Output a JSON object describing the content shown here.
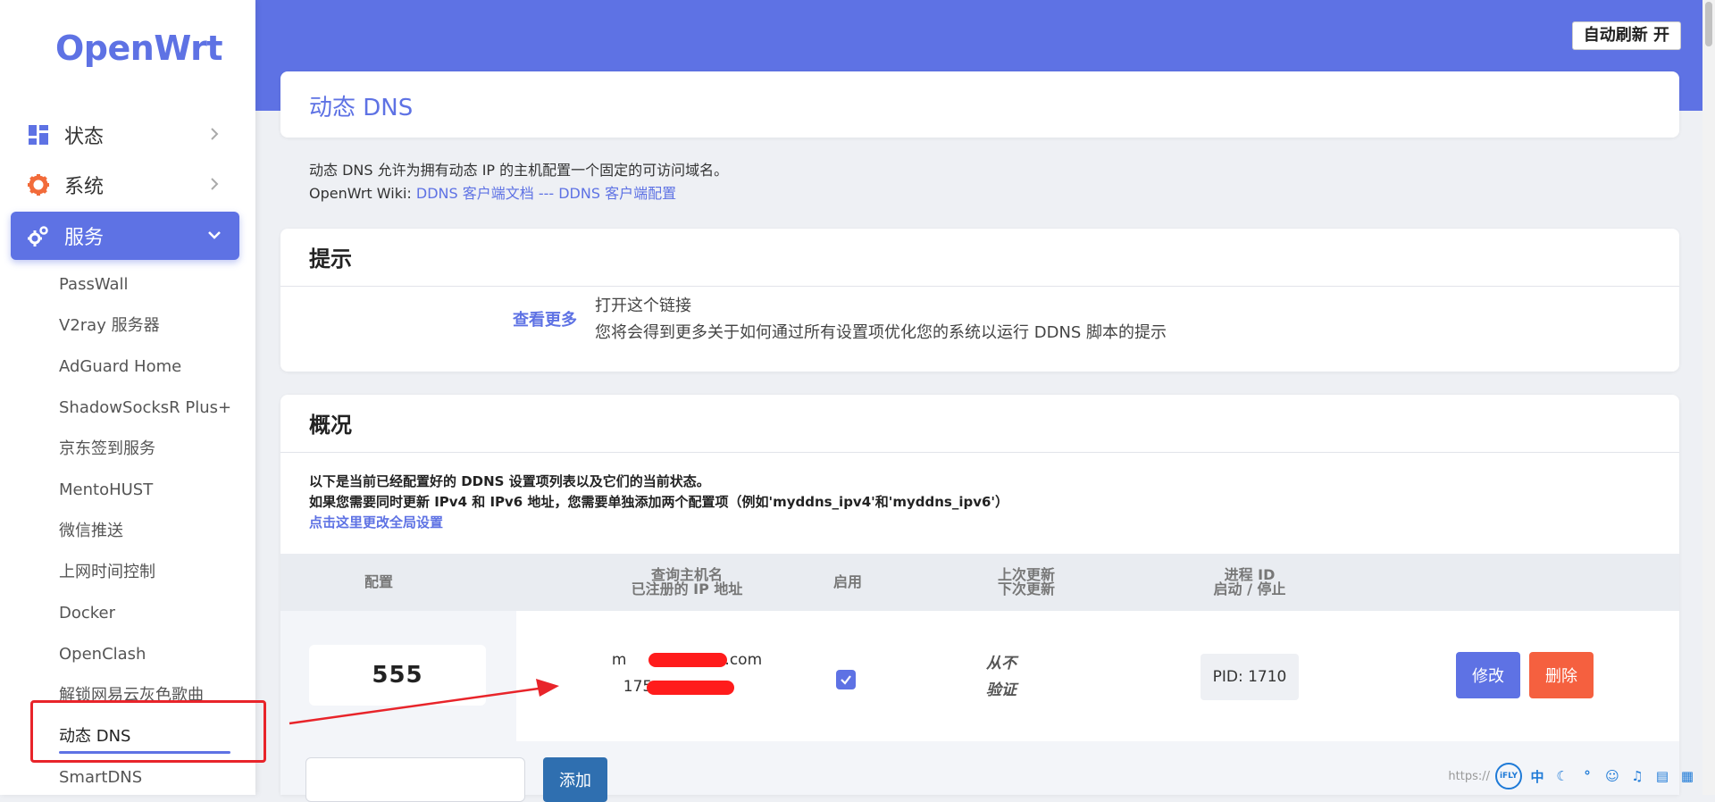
{
  "brand": "OpenWrt",
  "sidebar": {
    "top": [
      {
        "label": "状态",
        "icon": "dashboard-icon"
      },
      {
        "label": "系统",
        "icon": "gear-icon"
      },
      {
        "label": "服务",
        "icon": "services-gears-icon",
        "active": true
      }
    ],
    "sub": [
      "PassWall",
      "V2ray 服务器",
      "AdGuard Home",
      "ShadowSocksR Plus+",
      "京东签到服务",
      "MentoHUST",
      "微信推送",
      "上网时间控制",
      "Docker",
      "OpenClash",
      "解锁网易云灰色歌曲",
      "动态 DNS",
      "SmartDNS"
    ],
    "active_sub": "动态 DNS"
  },
  "header": {
    "refresh_label": "自动刷新 开"
  },
  "page": {
    "title": "动态 DNS",
    "desc_line1": "动态 DNS 允许为拥有动态 IP 的主机配置一个固定的可访问域名。",
    "desc_wiki_prefix": "OpenWrt Wiki: ",
    "desc_link1": "DDNS 客户端文档",
    "desc_sep": " --- ",
    "desc_link2": "DDNS 客户端配置"
  },
  "hint": {
    "heading": "提示",
    "link": "查看更多",
    "line1": "打开这个链接",
    "line2": "您将会得到更多关于如何通过所有设置项优化您的系统以运行 DDNS 脚本的提示"
  },
  "overview": {
    "heading": "概况",
    "line1": "以下是当前已经配置好的 DDNS 设置项列表以及它们的当前状态。",
    "line2": "如果您需要同时更新 IPv4 和 IPv6 地址，您需要单独添加两个配置项（例如'myddns_ipv4'和'myddns_ipv6'）",
    "link": "点击这里更改全局设置",
    "columns": {
      "config": "配置",
      "host_top": "查询主机名",
      "host_bottom": "已注册的 IP 地址",
      "enabled": "启用",
      "update_top": "上次更新",
      "update_bottom": "下次更新",
      "pid_top": "进程 ID",
      "pid_bottom": "启动 / 停止"
    },
    "rows": [
      {
        "name": "555",
        "host_prefix": "m",
        "host_suffix": ".com",
        "ip_prefix": "175",
        "enabled": true,
        "last_update": "从不",
        "next_update": "验证",
        "pid": "PID: 1710",
        "edit": "修改",
        "delete": "删除"
      }
    ],
    "add_label": "添加"
  },
  "ime": {
    "text": "https://",
    "brand": "iFLY",
    "lang": "中"
  },
  "colors": {
    "accent": "#5e72e4",
    "danger": "#f5603f",
    "highlight": "#e8242a",
    "add_button": "#2f6fb0"
  }
}
